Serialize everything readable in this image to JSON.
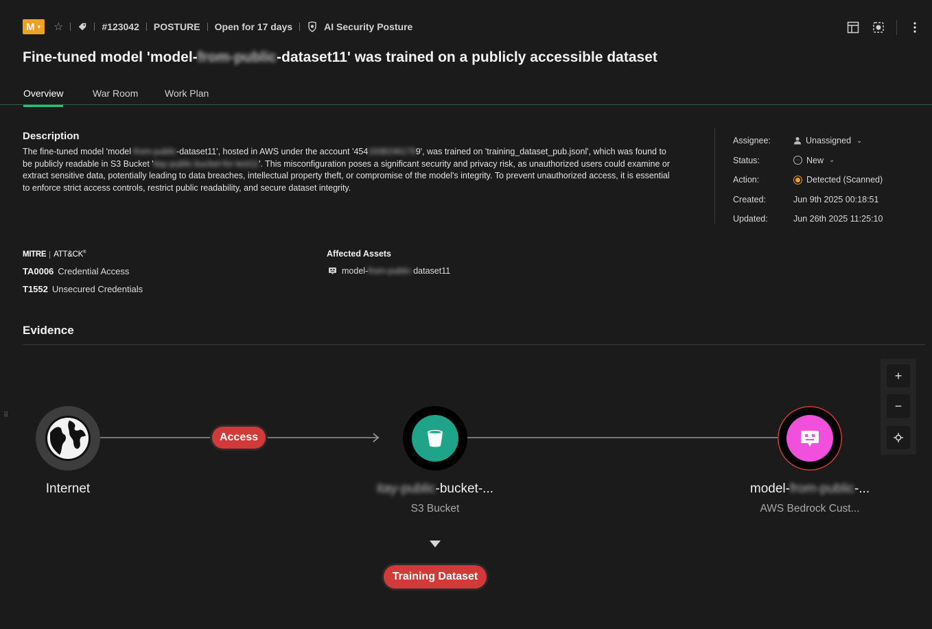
{
  "header": {
    "severity": "M",
    "case_id": "#123042",
    "category": "POSTURE",
    "open_for": "Open for 17 days",
    "source": "AI Security Posture"
  },
  "title": {
    "prefix": "Fine-tuned model 'model-",
    "hidden": "from-public",
    "suffix": "-dataset11' was trained on a publicly accessible dataset"
  },
  "tabs": [
    "Overview",
    "War Room",
    "Work Plan"
  ],
  "description": {
    "heading": "Description",
    "p1": "The fine-tuned model 'model",
    "p1_hidden": "-from-public",
    "p2": "-dataset11', hosted in AWS under the account '454",
    "p2_hidden": "1938246179",
    "p3": "9', was trained on 'training_dataset_pub.jsonl', which was found to be publicly readable in S3 Bucket '",
    "p3_hidden": "itay-public-bucket-for-test11",
    "p4": "'. This misconfiguration poses a significant security and privacy risk, as unauthorized users could examine or extract sensitive data, potentially leading to data breaches, intellectual property theft, or compromise of the model's integrity. To prevent unauthorized access, it is essential to enforce strict access controls, restrict public readability, and secure dataset integrity."
  },
  "meta": {
    "assignee_label": "Assignee:",
    "assignee": "Unassigned",
    "status_label": "Status:",
    "status": "New",
    "action_label": "Action:",
    "action": "Detected (Scanned)",
    "created_label": "Created:",
    "created": "Jun 9th 2025 00:18:51",
    "updated_label": "Updated:",
    "updated": "Jun 26th 2025 11:25:10",
    "action_color": "#f0a020"
  },
  "mitre": {
    "logo_left": "MITRE",
    "logo_right": "ATT&CK",
    "logo_mark": "®",
    "tactic_id": "TA0006",
    "tactic_name": "Credential Access",
    "technique_id": "T1552",
    "technique_name": "Unsecured Credentials"
  },
  "affected": {
    "heading": "Affected Assets",
    "asset_prefix": "model-",
    "asset_hidden": "from-public-",
    "asset_suffix": "dataset11"
  },
  "evidence": {
    "heading": "Evidence",
    "internet_label": "Internet",
    "access_label": "Access",
    "bucket_hidden": "itay-public",
    "bucket_label": "-bucket-...",
    "bucket_type": "S3 Bucket",
    "model_prefix": "model-",
    "model_hidden": "from-public",
    "model_suffix": "-...",
    "model_type": "AWS Bedrock Cust...",
    "dataset_label": "Training Dataset",
    "zoom_in": "+",
    "zoom_out": "−",
    "colors": {
      "bucket": "#1fa389",
      "model": "#f050dc",
      "pill": "#d23a3a"
    }
  }
}
